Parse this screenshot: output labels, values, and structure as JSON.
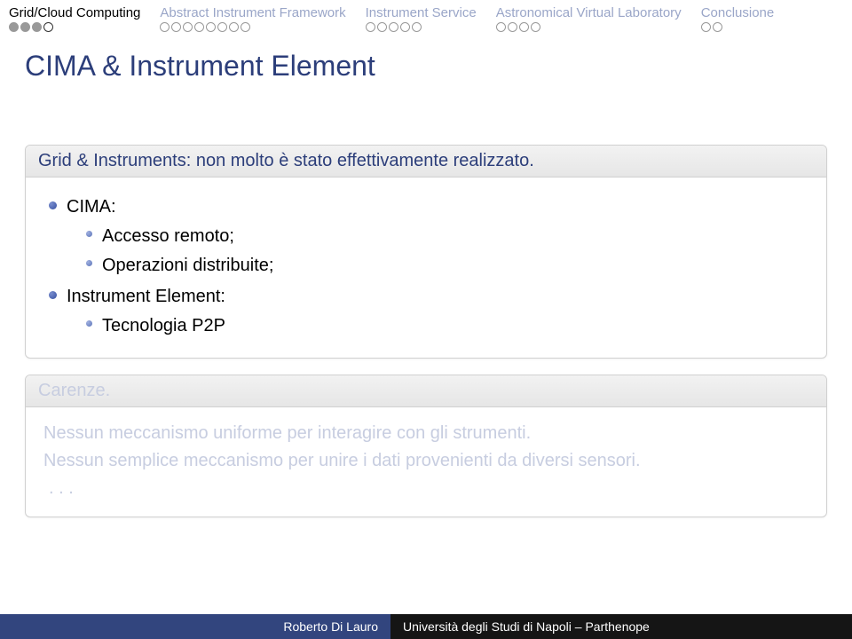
{
  "nav": [
    {
      "label": "Grid/Cloud Computing",
      "dots": 4,
      "active": true,
      "current": 3
    },
    {
      "label": "Abstract Instrument Framework",
      "dots": 8,
      "active": false
    },
    {
      "label": "Instrument Service",
      "dots": 5,
      "active": false
    },
    {
      "label": "Astronomical Virtual Laboratory",
      "dots": 4,
      "active": false
    },
    {
      "label": "Conclusione",
      "dots": 2,
      "active": false
    }
  ],
  "title": "CIMA & Instrument Element",
  "block1": {
    "heading": "Grid & Instruments: non molto è stato effettivamente realizzato.",
    "items": [
      {
        "text": "CIMA:",
        "sub": [
          "Accesso remoto;",
          "Operazioni distribuite;"
        ]
      },
      {
        "text": "Instrument Element:",
        "sub": [
          "Tecnologia P2P"
        ]
      }
    ]
  },
  "block2": {
    "heading": "Carenze.",
    "line1": "Nessun meccanismo uniforme per interagire con gli strumenti.",
    "line2": "Nessun semplice meccanismo per unire i dati provenienti da diversi sensori.",
    "ellipsis": ". . ."
  },
  "footer": {
    "author": "Roberto Di Lauro",
    "affiliation": "Università degli Studi di Napoli – Parthenope"
  }
}
